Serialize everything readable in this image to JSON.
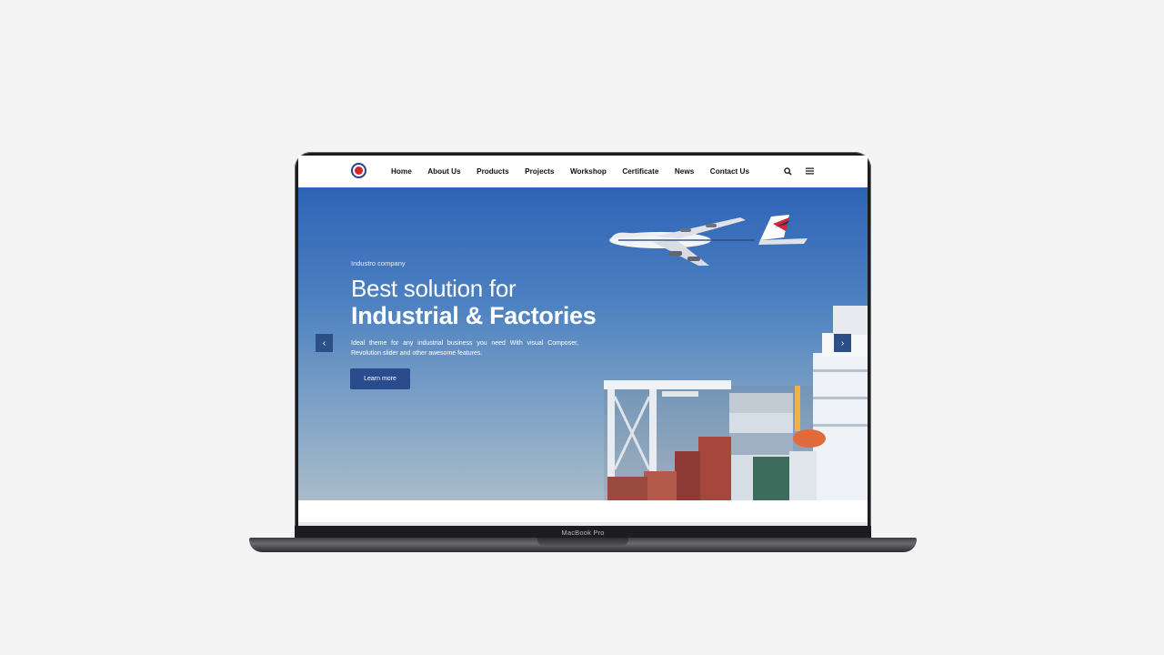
{
  "device": {
    "label": "MacBook Pro"
  },
  "nav": {
    "items": [
      {
        "label": "Home"
      },
      {
        "label": "About Us"
      },
      {
        "label": "Products"
      },
      {
        "label": "Projects"
      },
      {
        "label": "Workshop"
      },
      {
        "label": "Certificate"
      },
      {
        "label": "News"
      },
      {
        "label": "Contact Us"
      }
    ],
    "icons": [
      "search-icon",
      "menu-icon"
    ]
  },
  "hero": {
    "subtitle": "Industro company",
    "title_line1": "Best solution for",
    "title_line2": "Industrial & Factories",
    "description": "Ideal theme for any industrial business you need With visual Composer, Revolution slider and other awesome features.",
    "cta_label": "Learn more",
    "prev_icon": "chevron-left-icon",
    "next_icon": "chevron-right-icon"
  },
  "colors": {
    "brand_blue": "#2a4c8e",
    "brand_red": "#d6262b",
    "sky_top": "#2e64b6",
    "sky_bottom": "#a9bccb"
  }
}
